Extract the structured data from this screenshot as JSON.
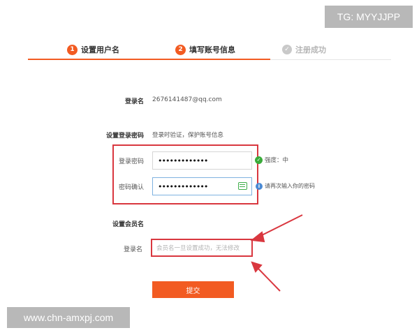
{
  "watermarks": {
    "top": "TG: MYYJJPP",
    "bottom": "www.chn-amxpj.com"
  },
  "steps": [
    {
      "number": "1",
      "label": "设置用户名"
    },
    {
      "number": "2",
      "label": "填写账号信息"
    },
    {
      "number": "",
      "label": "注册成功"
    }
  ],
  "login": {
    "label": "登录名",
    "value": "2676141487@qq.com"
  },
  "password_section": {
    "label": "设置登录密码",
    "hint": "登录时验证，保护账号信息"
  },
  "password": {
    "label": "登录密码",
    "value": "•••••••••••••",
    "strength_label": "强度：中"
  },
  "confirm": {
    "label": "密码确认",
    "value": "•••••••••••••",
    "hint": "请再次输入你的密码"
  },
  "member_section": {
    "label": "设置会员名"
  },
  "member": {
    "label": "登录名",
    "placeholder": "会员名一旦设置成功，无法修改"
  },
  "submit": {
    "label": "提交"
  },
  "colors": {
    "accent": "#f25b22",
    "annotation": "#d9373f",
    "ok": "#3aab3a",
    "info": "#4a8ad4"
  }
}
